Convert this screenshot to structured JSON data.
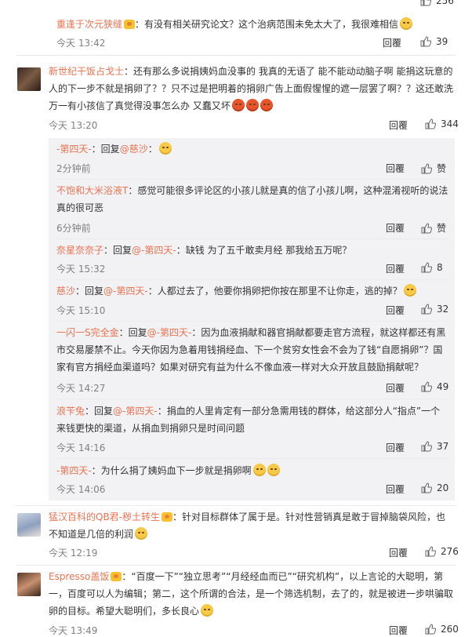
{
  "top_partial": {
    "likes": "256"
  },
  "comments": [
    {
      "user": "重逢于次元狭缝",
      "text": "：有没有相关研究论文？这个治病范围未免太大了，我很难相信",
      "time": "今天 13:42",
      "reply": "回覆",
      "likes": "39"
    },
    {
      "user": "新世纪干饭占戈士",
      "text": "：还有那么多说捐姨妈血没事的 我真的无语了 能不能动动脑子啊 能捐这玩意的人的下一步不就是捐卵了？？只不过是把明着的捐卵广告上面假惺惺的遮一层罢了啊？？这还敢洗万一有小孩信了真觉得没事怎么办 又蠢又坏",
      "time": "今天 13:20",
      "reply": "回覆",
      "likes": "344"
    },
    {
      "user": "猛汉百科的QB君-秽土转生",
      "text": "：针对目标群体了属于是。针对性营销真是敢于冒掉脑袋风险，也不知道是几倍的利润",
      "time": "今天 12:19",
      "reply": "回覆",
      "likes": "276"
    },
    {
      "user": "Espresso盖饭",
      "text": "：“百度一下”“独立思考”“月经经血而已”“研究机构”，以上言论的大聪明，第一，百度可以人为编辑；第二，这个所谓的合法，是一个筛选机制，去了的，就是被进一步哄骗取卵的目标。希望大聪明们，多长良心",
      "time": "今天 13:49",
      "reply": "回覆",
      "likes": "260"
    }
  ],
  "subreplies": [
    {
      "user": "-第四天-",
      "pre": "：回复",
      "mention": "@慈沙",
      "text": "：",
      "time": "2分钟前",
      "reply": "回覆",
      "likes": "赞"
    },
    {
      "user": "不饱和大米浴液T",
      "pre": "",
      "mention": "",
      "text": "：感觉可能很多评论区的小孩儿就是真的信了小孩儿啊，这种混淆视听的说法真的很可恶",
      "time": "6分钟前",
      "reply": "回覆",
      "likes": "赞"
    },
    {
      "user": "奈星奈奈子",
      "pre": "：回复",
      "mention": "@-第四天-",
      "text": "：缺钱 为了五千敢卖月经 那我给五万呢？",
      "time": "今天 15:32",
      "reply": "回覆",
      "likes": "8"
    },
    {
      "user": "慈沙",
      "pre": "：回复",
      "mention": "@-第四天-",
      "text": "：人都过去了，他要你捐卵把你按在那里不让你走，逃的掉？",
      "time": "今天 15:10",
      "reply": "回覆",
      "likes": "32"
    },
    {
      "user": "一闪一S完全金",
      "pre": "：回复",
      "mention": "@-第四天-",
      "text": "：因为血液捐献和器官捐献都要走官方流程，就这样都还有黑市交易屡禁不止。今天你因为急着用钱捐经血、下一个贫穷女性会不会为了钱“自愿捐卵”？国家有官方捐经血渠道吗？如果对研究有益为什么不像血液一样对大众开放且鼓励捐献呢？",
      "time": "今天 14:27",
      "reply": "回覆",
      "likes": "49"
    },
    {
      "user": "浪苄兔",
      "pre": "：回复",
      "mention": "@-第四天-",
      "text": "：捐血的人里肯定有一部分急需用钱的群体，给这部分人“指点”一个来钱更快的渠道，从捐血到捐卵只是时间问题",
      "time": "今天 14:16",
      "reply": "回覆",
      "likes": "37"
    },
    {
      "user": "-第四天-",
      "pre": "",
      "mention": "",
      "text": "：为什么捐了姨妈血下一步就是捐卵啊",
      "time": "今天 14:06",
      "reply": "回覆",
      "likes": "20"
    }
  ]
}
